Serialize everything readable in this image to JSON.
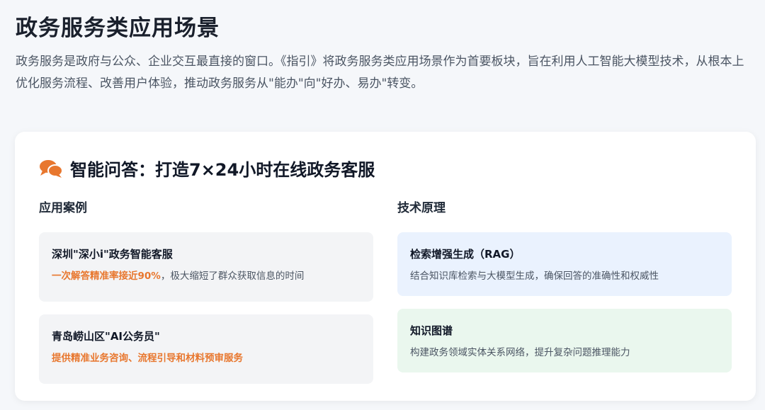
{
  "page": {
    "title": "政务服务类应用场景",
    "intro": "政务服务是政府与公众、企业交互最直接的窗口。《指引》将政务服务类应用场景作为首要板块，旨在利用人工智能大模型技术，从根本上优化服务流程、改善用户体验，推动政务服务从\"能办\"向\"好办、易办\"转变。"
  },
  "card": {
    "icon": "chat-bubbles-icon",
    "title": "智能问答：打造7×24小时在线政务客服",
    "cases": {
      "heading": "应用案例",
      "items": [
        {
          "title": "深圳\"深小i\"政务智能客服",
          "highlight": "一次解答精准率接近90%",
          "desc": "，极大缩短了群众获取信息的时间"
        },
        {
          "title": "青岛崂山区\"AI公务员\"",
          "highlight": "提供精准业务咨询、流程引导和材料预审服务",
          "desc": ""
        }
      ]
    },
    "tech": {
      "heading": "技术原理",
      "items": [
        {
          "title": "检索增强生成（RAG）",
          "desc": "结合知识库检索与大模型生成，确保回答的准确性和权威性"
        },
        {
          "title": "知识图谱",
          "desc": "构建政务领域实体关系网络，提升复杂问题推理能力"
        }
      ]
    }
  },
  "colors": {
    "accent": "#e8772e",
    "blue_bg": "#eaf2fe",
    "green_bg": "#eaf7ee",
    "gray_bg": "#f3f4f6"
  }
}
